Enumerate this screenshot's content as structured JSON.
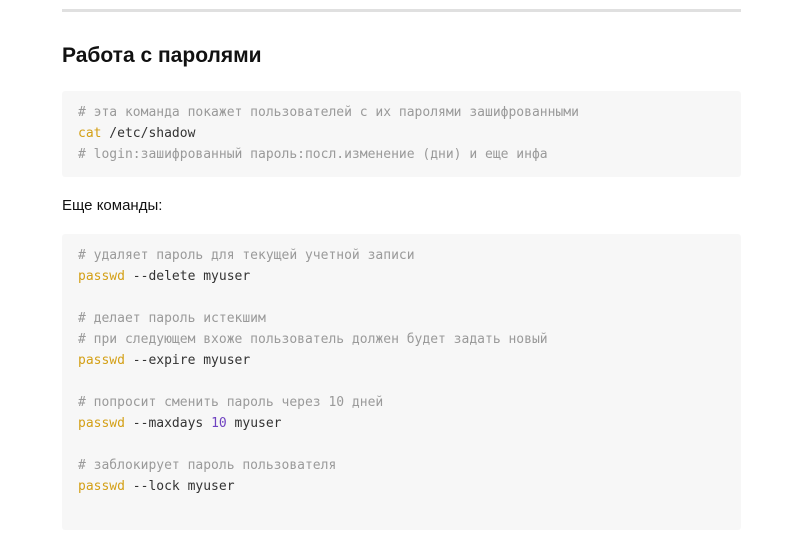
{
  "section": {
    "title": "Работа с паролями"
  },
  "block1": {
    "line1_comment": "# эта команда покажет пользователей с их паролями зашифрованными",
    "line2_cmd": "cat",
    "line2_args": " /etc/shadow",
    "line3_comment": "# login:зашифрованный пароль:посл.изменение (дни) и еще инфа"
  },
  "more_commands": "Еще команды:",
  "block2": {
    "c1": "# удаляет пароль для текущей учетной записи",
    "cmd1": "passwd",
    "args1": " --delete myuser",
    "c2": "# делает пароль истекшим",
    "c3": "# при следующем вхоже пользователь должен будет задать новый",
    "cmd2": "passwd",
    "args2": " --expire myuser",
    "c4": "# попросит сменить пароль через 10 дней",
    "cmd3": "passwd",
    "args3a": " --maxdays ",
    "num3": "10",
    "args3b": " myuser",
    "c5": "# заблокирует пароль пользователя",
    "cmd4": "passwd",
    "args4": " --lock myuser"
  },
  "colors": {
    "comment": "#9a9a9a",
    "keyword": "#d4a017",
    "number": "#6f42c1",
    "code_bg": "#f7f7f7"
  }
}
